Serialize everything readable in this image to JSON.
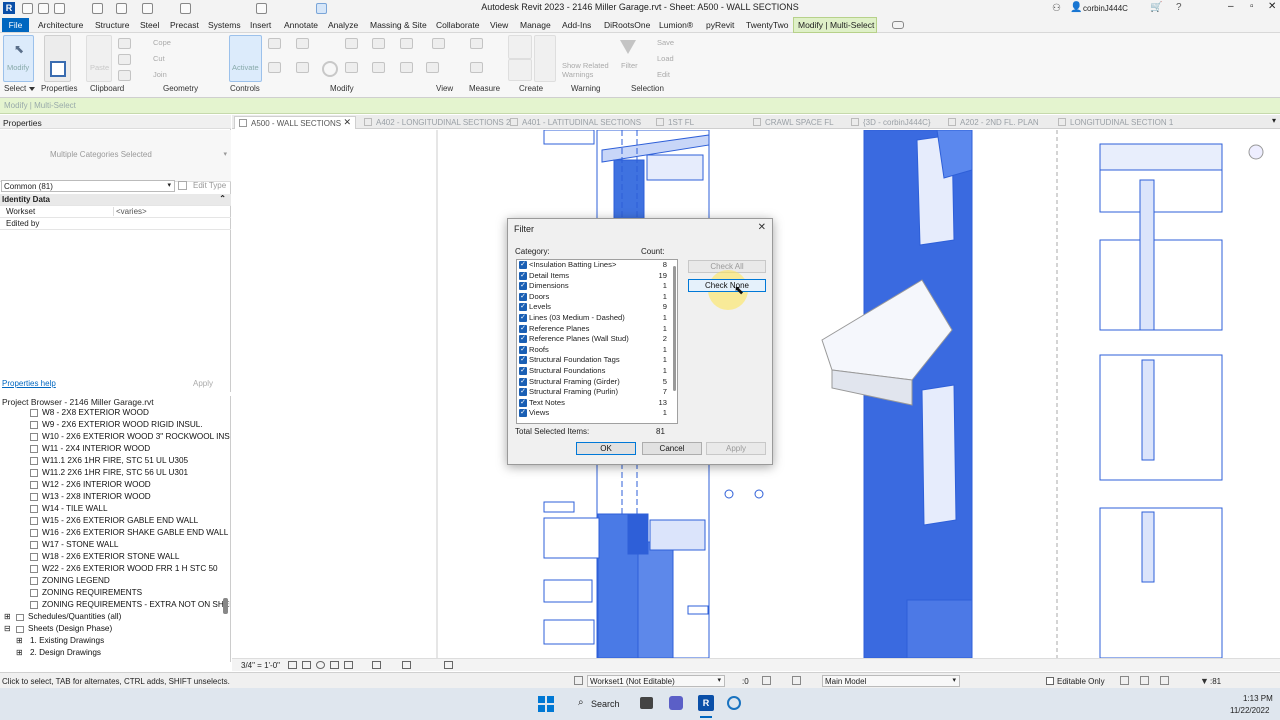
{
  "title_bar": {
    "title": "Autodesk Revit 2023 - 2146 Miller Garage.rvt - Sheet: A500 - WALL SECTIONS",
    "user": "corbinJ444C"
  },
  "menu": {
    "file": "File",
    "items": [
      "Architecture",
      "Structure",
      "Steel",
      "Precast",
      "Systems",
      "Insert",
      "Annotate",
      "Analyze",
      "Massing & Site",
      "Collaborate",
      "View",
      "Manage",
      "Add-Ins",
      "DiRootsOne",
      "Lumion®",
      "pyRevit",
      "TwentyTwo"
    ],
    "active": "Modify | Multi-Select"
  },
  "ribbon": {
    "modify_label": "Modify",
    "paste_label": "Paste",
    "cope_label": "Cope",
    "cut_label": "Cut",
    "join_label": "Join",
    "activate_label": "Activate",
    "show_related_label": "Show Related Warnings",
    "filter_label": "Filter",
    "save_label": "Save",
    "load_label": "Load",
    "edit_label": "Edit",
    "groups": [
      "Select",
      "Properties",
      "Clipboard",
      "Geometry",
      "Controls",
      "Modify",
      "View",
      "Measure",
      "Create",
      "Warning",
      "Selection"
    ]
  },
  "context_bar": "Modify | Multi-Select",
  "properties": {
    "header": "Properties",
    "type_selector": "Multiple Categories Selected",
    "instance_filter": "Common (81)",
    "edit_type": "Edit Type",
    "section": "Identity Data",
    "rows": [
      {
        "name": "Workset",
        "value": "<varies>"
      },
      {
        "name": "Edited by",
        "value": ""
      }
    ],
    "help_link": "Properties help",
    "apply": "Apply"
  },
  "project_browser": {
    "header": "Project Browser - 2146 Miller Garage.rvt",
    "items": [
      "W8 - 2X8 EXTERIOR WOOD",
      "W9 - 2X6 EXTERIOR WOOD RIGID INSUL.",
      "W10 - 2X6 EXTERIOR WOOD 3\" ROCKWOOL INSUL",
      "W11 - 2X4 INTERIOR WOOD",
      "W11.1 2X6 1HR FIRE, STC 51 UL U305",
      "W11.2 2X6 1HR FIRE, STC 56 UL U301",
      "W12 - 2X6 INTERIOR WOOD",
      "W13 - 2X8 INTERIOR WOOD",
      "W14 - TILE WALL",
      "W15 - 2X6 EXTERIOR GABLE END WALL",
      "W16 - 2X6 EXTERIOR SHAKE GABLE END WALL",
      "W17 - STONE WALL",
      "W18 - 2X6 EXTERIOR STONE WALL",
      "W22 - 2X6 EXTERIOR WOOD FRR 1 H STC 50",
      "ZONING LEGEND",
      "ZONING REQUIREMENTS",
      "ZONING REQUIREMENTS - EXTRA NOT ON SHEET"
    ],
    "folders": [
      "Schedules/Quantities (all)",
      "Sheets (Design Phase)",
      "1. Existing Drawings",
      "2. Design Drawings"
    ]
  },
  "tabs": [
    {
      "label": "A500 - WALL SECTIONS",
      "active": true
    },
    {
      "label": "A402 - LONGITUDINAL SECTIONS 2",
      "active": false
    },
    {
      "label": "A401 - LATITUDINAL SECTIONS",
      "active": false
    },
    {
      "label": "1ST FL",
      "active": false
    },
    {
      "label": "CRAWL SPACE FL",
      "active": false
    },
    {
      "label": "{3D - corbinJ444C}",
      "active": false
    },
    {
      "label": "A202 - 2ND FL. PLAN",
      "active": false
    },
    {
      "label": "LONGITUDINAL SECTION 1",
      "active": false
    }
  ],
  "filter_dialog": {
    "title": "Filter",
    "category_label": "Category:",
    "count_label": "Count:",
    "categories": [
      {
        "name": "<Insulation Batting Lines>",
        "count": "8"
      },
      {
        "name": "Detail Items",
        "count": "19"
      },
      {
        "name": "Dimensions",
        "count": "1"
      },
      {
        "name": "Doors",
        "count": "1"
      },
      {
        "name": "Levels",
        "count": "9"
      },
      {
        "name": "Lines (03 Medium - Dashed)",
        "count": "1"
      },
      {
        "name": "Reference Planes",
        "count": "1"
      },
      {
        "name": "Reference Planes (Wall Stud)",
        "count": "2"
      },
      {
        "name": "Roofs",
        "count": "1"
      },
      {
        "name": "Structural Foundation Tags",
        "count": "1"
      },
      {
        "name": "Structural Foundations",
        "count": "1"
      },
      {
        "name": "Structural Framing (Girder)",
        "count": "5"
      },
      {
        "name": "Structural Framing (Purlin)",
        "count": "7"
      },
      {
        "name": "Text Notes",
        "count": "13"
      },
      {
        "name": "Views",
        "count": "1"
      }
    ],
    "check_all": "Check All",
    "check_none": "Check None",
    "total_label": "Total Selected Items:",
    "total_value": "81",
    "ok": "OK",
    "cancel": "Cancel",
    "apply": "Apply"
  },
  "view_bar": {
    "scale": "3/4\" = 1'-0\""
  },
  "status_bar": {
    "message": "Click to select, TAB for alternates, CTRL adds, SHIFT unselects.",
    "workset": "Workset1 (Not Editable)",
    "zero": ":0",
    "model": "Main Model",
    "editable_only": "Editable Only",
    "selected": ":81"
  },
  "taskbar": {
    "search": "Search",
    "time": "1:13 PM",
    "date": "11/22/2022"
  },
  "colors": {
    "accent": "#0067c0",
    "context": "#dff0c8",
    "selection_blue": "#2e5fd8",
    "checkbox": "#1a5fb4"
  }
}
